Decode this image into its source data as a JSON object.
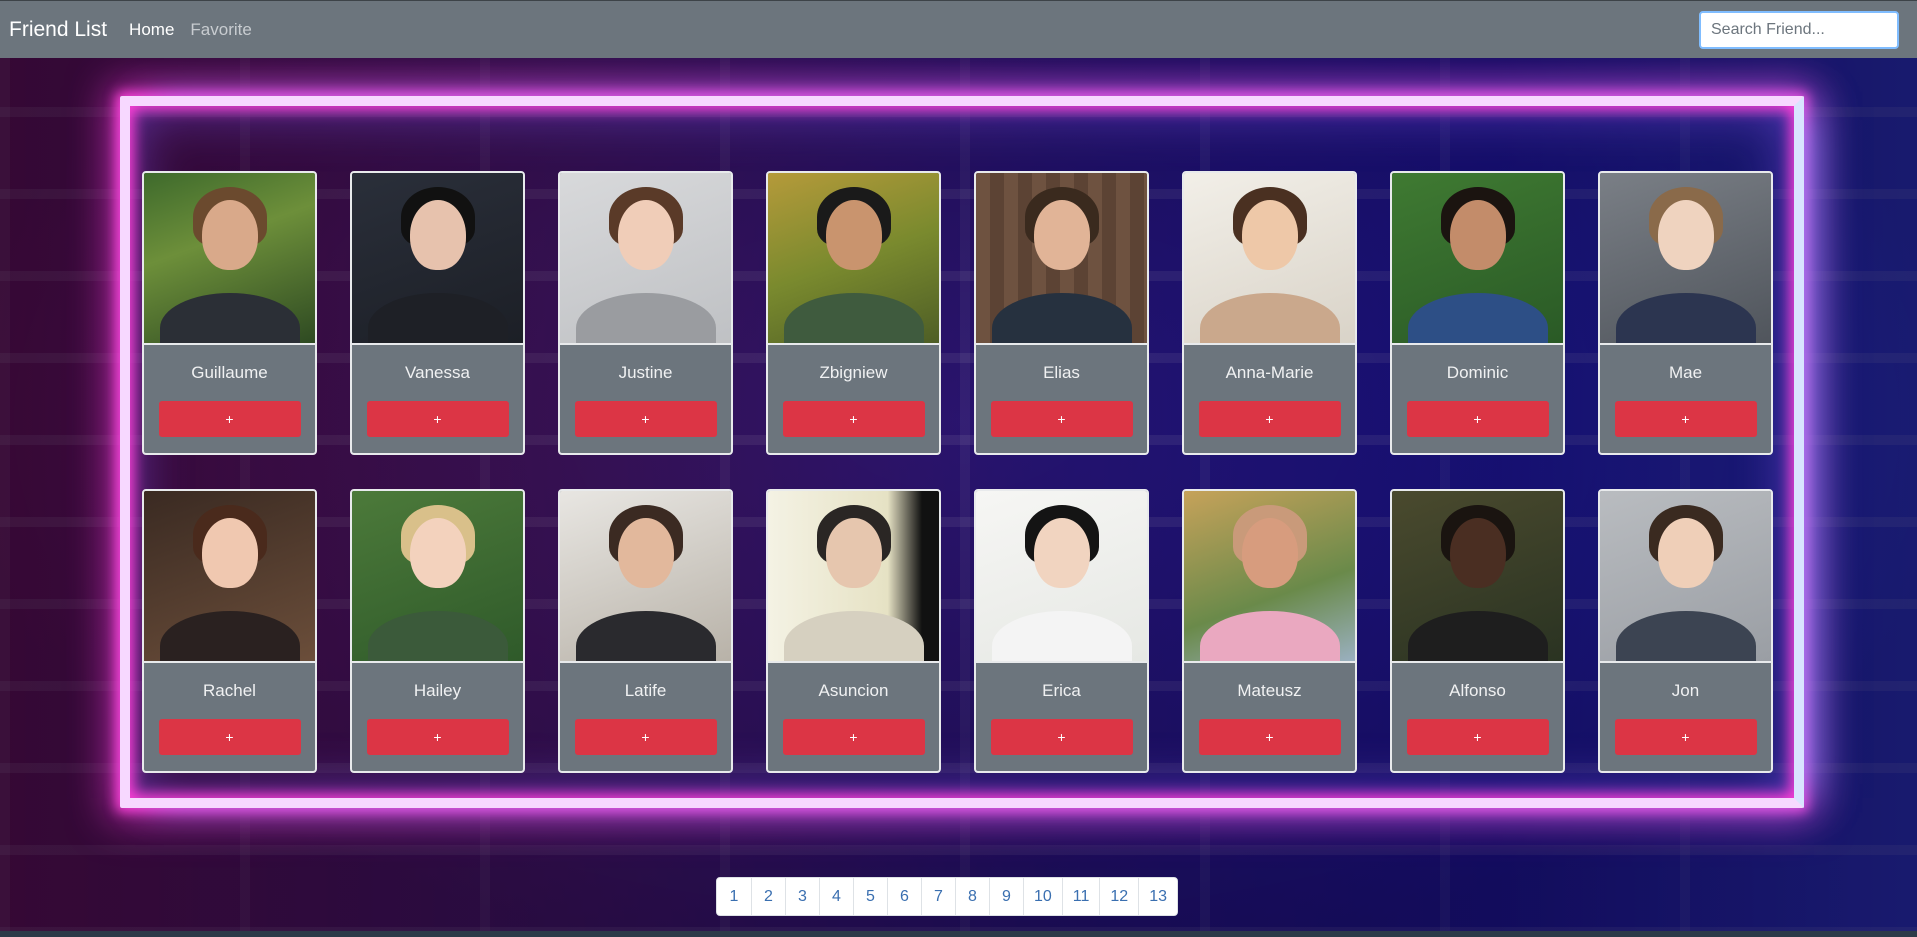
{
  "navbar": {
    "brand": "Friend List",
    "links": [
      {
        "label": "Home"
      },
      {
        "label": "Favorite"
      }
    ],
    "search_placeholder": "Search Friend..."
  },
  "friends": [
    {
      "name": "Guillaume",
      "add_label": "+"
    },
    {
      "name": "Vanessa",
      "add_label": "+"
    },
    {
      "name": "Justine",
      "add_label": "+"
    },
    {
      "name": "Zbigniew",
      "add_label": "+"
    },
    {
      "name": "Elias",
      "add_label": "+"
    },
    {
      "name": "Anna-Marie",
      "add_label": "+"
    },
    {
      "name": "Dominic",
      "add_label": "+"
    },
    {
      "name": "Mae",
      "add_label": "+"
    },
    {
      "name": "Rachel",
      "add_label": "+"
    },
    {
      "name": "Hailey",
      "add_label": "+"
    },
    {
      "name": "Latife",
      "add_label": "+"
    },
    {
      "name": "Asuncion",
      "add_label": "+"
    },
    {
      "name": "Erica",
      "add_label": "+"
    },
    {
      "name": "Mateusz",
      "add_label": "+"
    },
    {
      "name": "Alfonso",
      "add_label": "+"
    },
    {
      "name": "Jon",
      "add_label": "+"
    }
  ],
  "pagination": [
    "1",
    "2",
    "3",
    "4",
    "5",
    "6",
    "7",
    "8",
    "9",
    "10",
    "11",
    "12",
    "13"
  ],
  "colors": {
    "navbar": "#6c757d",
    "card": "#6c757d",
    "add_button": "#dc3545",
    "page_link": "#3a6fb0"
  }
}
